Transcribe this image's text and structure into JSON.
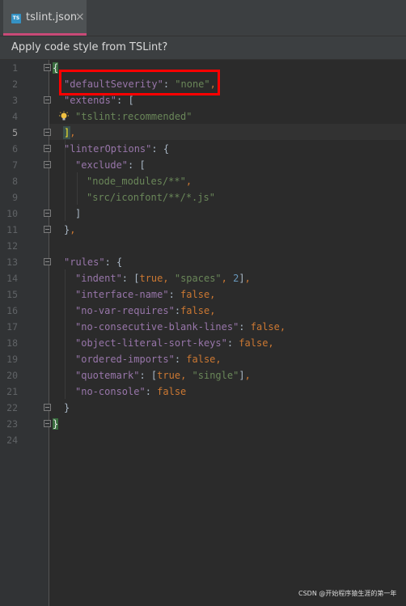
{
  "tab": {
    "icon": "TS",
    "title": "tslint.json",
    "close": "×"
  },
  "banner": {
    "text": "Apply code style from TSLint?"
  },
  "lines": [
    {
      "no": "1"
    },
    {
      "no": "2"
    },
    {
      "no": "3"
    },
    {
      "no": "4"
    },
    {
      "no": "5"
    },
    {
      "no": "6"
    },
    {
      "no": "7"
    },
    {
      "no": "8"
    },
    {
      "no": "9"
    },
    {
      "no": "10"
    },
    {
      "no": "11"
    },
    {
      "no": "12"
    },
    {
      "no": "13"
    },
    {
      "no": "14"
    },
    {
      "no": "15"
    },
    {
      "no": "16"
    },
    {
      "no": "17"
    },
    {
      "no": "18"
    },
    {
      "no": "19"
    },
    {
      "no": "20"
    },
    {
      "no": "21"
    },
    {
      "no": "22"
    },
    {
      "no": "23"
    },
    {
      "no": "24"
    }
  ],
  "code": {
    "l2_key": "\"defaultSeverity\"",
    "l2_val": "\"none\"",
    "l3_key": "\"extends\"",
    "l4_val": "\"tslint:recommended\"",
    "l6_key": "\"linterOptions\"",
    "l7_key": "\"exclude\"",
    "l8_val": "\"node_modules/**\"",
    "l9_val": "\"src/iconfont/**/*.js\"",
    "l13_key": "\"rules\"",
    "l14_key": "\"indent\"",
    "l14_b": "true",
    "l14_s": "\"spaces\"",
    "l14_n": "2",
    "l15_key": "\"interface-name\"",
    "l15_v": "false",
    "l16_key": "\"no-var-requires\"",
    "l16_v": "false",
    "l17_key": "\"no-consecutive-blank-lines\"",
    "l17_v": "false",
    "l18_key": "\"object-literal-sort-keys\"",
    "l18_v": "false",
    "l19_key": "\"ordered-imports\"",
    "l19_v": "false",
    "l20_key": "\"quotemark\"",
    "l20_b": "true",
    "l20_s": "\"single\"",
    "l21_key": "\"no-console\"",
    "l21_v": "false"
  },
  "watermark": "CSDN @开始程序猿生涯的第一年",
  "colors": {
    "background": "#2b2b2b",
    "key": "#9876aa",
    "string": "#6a8759",
    "number": "#6897bb",
    "keyword": "#cc7832",
    "highlight": "#ff0000",
    "tab_underline": "#c94a78"
  }
}
